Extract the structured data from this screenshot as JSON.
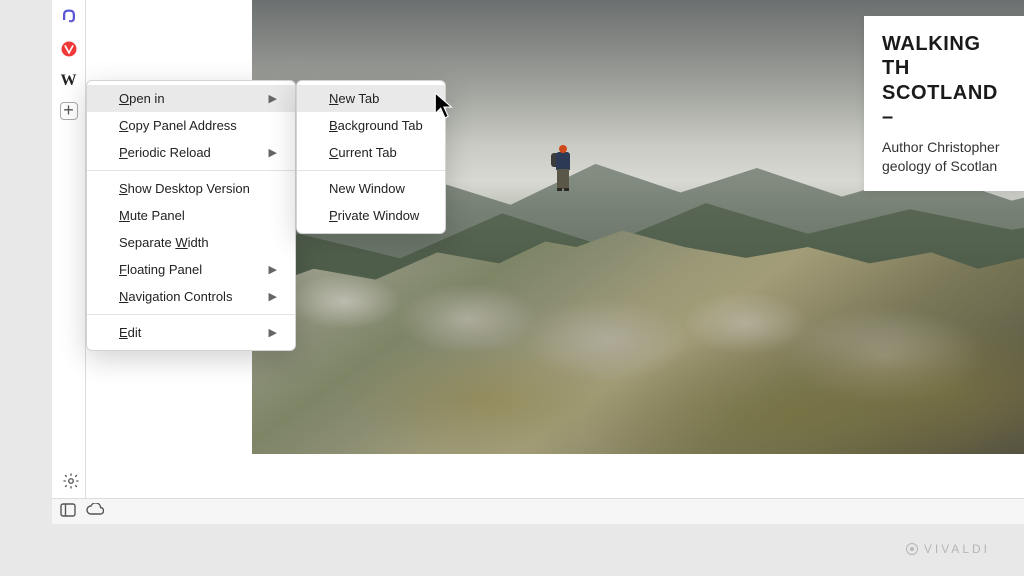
{
  "panel_icons": {
    "mastodon": "mastodon-icon",
    "vivaldi": "vivaldi-icon",
    "wikipedia": "W",
    "add": "+"
  },
  "article": {
    "title": "WALKING TH\nSCOTLAND –",
    "subtitle": "Author Christopher\ngeology of Scotlan"
  },
  "menu": {
    "open_in": "Open in",
    "copy_panel_address": "Copy Panel Address",
    "periodic_reload": "Periodic Reload",
    "show_desktop_version": "Show Desktop Version",
    "mute_panel": "Mute Panel",
    "separate_width": "Separate Width",
    "floating_panel": "Floating Panel",
    "navigation_controls": "Navigation Controls",
    "edit": "Edit"
  },
  "submenu": {
    "new_tab": "New Tab",
    "background_tab": "Background Tab",
    "current_tab": "Current Tab",
    "new_window": "New Window",
    "private_window": "Private Window"
  },
  "brand": "VIVALDI"
}
